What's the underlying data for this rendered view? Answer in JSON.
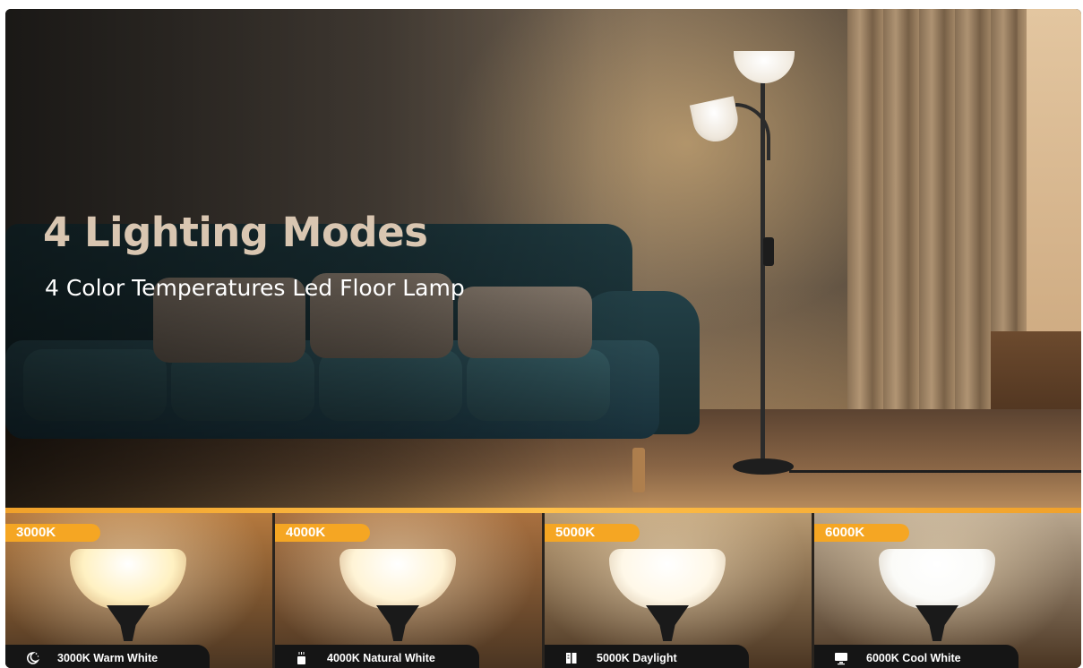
{
  "hero": {
    "title": "4 Lighting Modes",
    "subtitle": "4 Color Temperatures Led Floor Lamp"
  },
  "modes": [
    {
      "badge": "3000K",
      "label": "3000K Warm White",
      "icon": "moon-stars-icon",
      "bg": "#b5793e",
      "bulb": "#fff1c2"
    },
    {
      "badge": "4000K",
      "label": "4000K Natural White",
      "icon": "coffee-cup-icon",
      "bg": "#a9703f",
      "bulb": "#fff4d6"
    },
    {
      "badge": "5000K",
      "label": "5000K Daylight",
      "icon": "book-icon",
      "bg": "#b89a72",
      "bulb": "#fff8e8"
    },
    {
      "badge": "6000K",
      "label": "6000K Cool White",
      "icon": "monitor-icon",
      "bg": "#b7a58d",
      "bulb": "#fbfbf8"
    }
  ],
  "colors": {
    "accent": "#f5a623",
    "caption_bg": "#151515"
  }
}
